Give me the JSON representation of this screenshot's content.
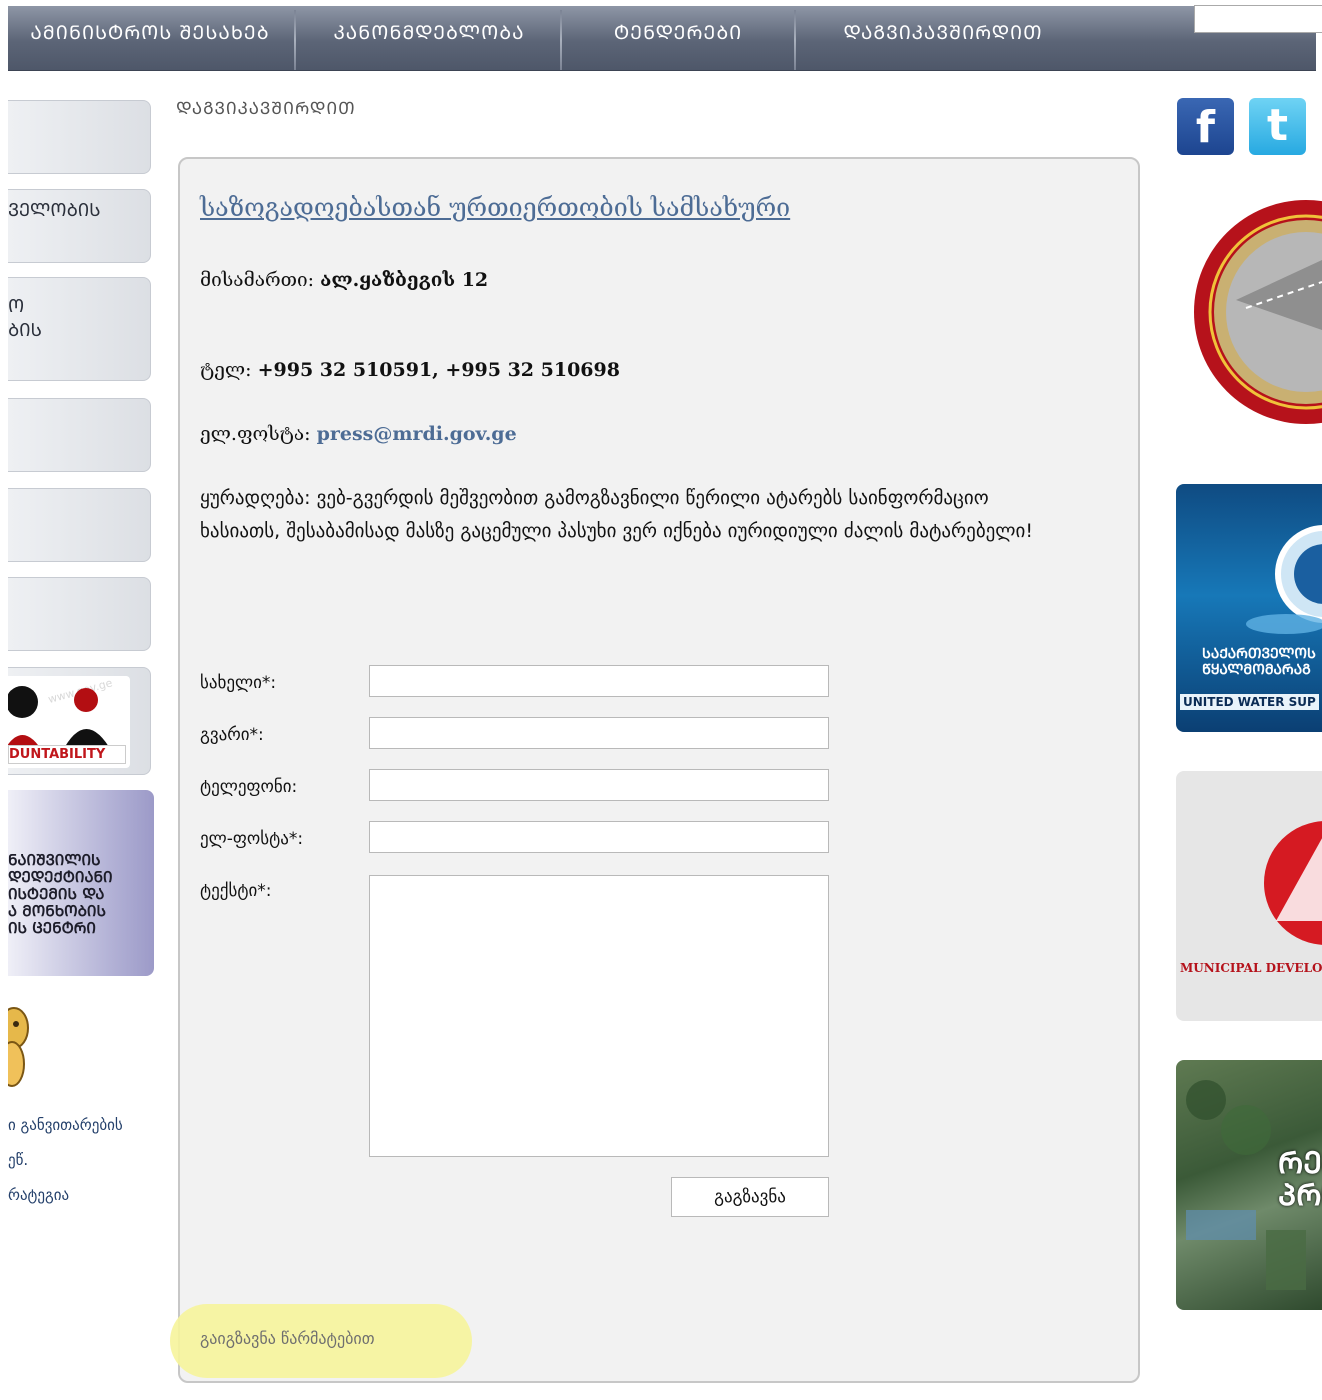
{
  "nav": {
    "items": [
      "ᲐᲛᲘᲜᲘᲡᲢᲠᲝᲡ ᲨᲔᲡᲐᲮᲔᲑ",
      "ᲙᲐᲜᲝᲜᲛᲓᲔᲑᲚᲝᲑᲐ",
      "ᲢᲔᲜᲓᲔᲠᲔᲑᲘ",
      "ᲓᲐᲒᲕᲘᲙᲐᲕᲨᲘᲠᲓᲘᲗ"
    ]
  },
  "sidebar": {
    "tab_2_label": "ᲕᲔᲚᲝᲑᲘᲡ",
    "tab_3_line1": "Ო",
    "tab_3_line2": "ᲑᲘᲡ",
    "accountability_text": "DUNTABILITY",
    "center_banner_lines": [
      "ᲜᲐᲘᲨᲕᲘᲚᲘᲡ",
      "ᲓᲔᲓᲔᲥᲢᲘᲐᲜᲘ",
      "ᲘᲡᲢᲔᲛᲘᲡ ᲓᲐ",
      "Ა ᲛᲝᲜᲮᲝᲑᲘᲡ",
      "ᲘᲡ ᲪᲔᲜᲢᲠᲘ"
    ],
    "dev_links": [
      "ი განვითარების",
      "ეწ.",
      "რატეგია"
    ]
  },
  "breadcrumb": "ᲓᲐᲒᲕᲘᲙᲐᲕᲨᲘᲠᲓᲘᲗ",
  "content": {
    "department": "საზოგადოებასთან ურთიერთობის სამსახური",
    "address_label": "მისამართი:",
    "address_value": "ალ.ყაზბეგის 12",
    "phone_label": "ტელ:",
    "phone_value": "+995 32 510591, +995 32 510698",
    "email_label": "ელ.ფოსტა:",
    "email_value": "press@mrdi.gov.ge",
    "notice": "ყურადღება: ვებ-გვერდის მეშვეობით გამოგზავნილი წერილი ატარებს საინფორმაციო ხასიათს, შესაბამისად მასზე გაცემული პასუხი ვერ იქნება იურიდიული ძალის მატარებელი!"
  },
  "form": {
    "name_label": "სახელი*:",
    "surname_label": "გვარი*:",
    "phone_label": "ტელეფონი:",
    "email_label": "ელ-ფოსტა*:",
    "text_label": "ტექსტი*:",
    "submit_label": "გაგზავნა",
    "success_message": "გაიგზავნა წარმატებით"
  },
  "right": {
    "facebook_glyph": "f",
    "twitter_glyph": "t",
    "water_banner_line1": "ᲡᲐᲥᲐᲠᲗᲕᲔᲚᲝᲡ",
    "water_banner_line2": "ᲬᲧᲐᲚᲛᲝᲛᲐᲠᲐᲒ",
    "water_banner_en": "UNITED WATER SUP",
    "municipal_banner_en": "MUNICIPAL DEVELO",
    "regional_banner_line1": "ᲠᲔᲒᲘ",
    "regional_banner_line2": "ᲞᲠᲝ"
  },
  "colors": {
    "nav_bg": "#5c6577",
    "link": "#4d6c95",
    "panel_bg": "#f2f2f2",
    "highlight": "#f6f49b"
  }
}
